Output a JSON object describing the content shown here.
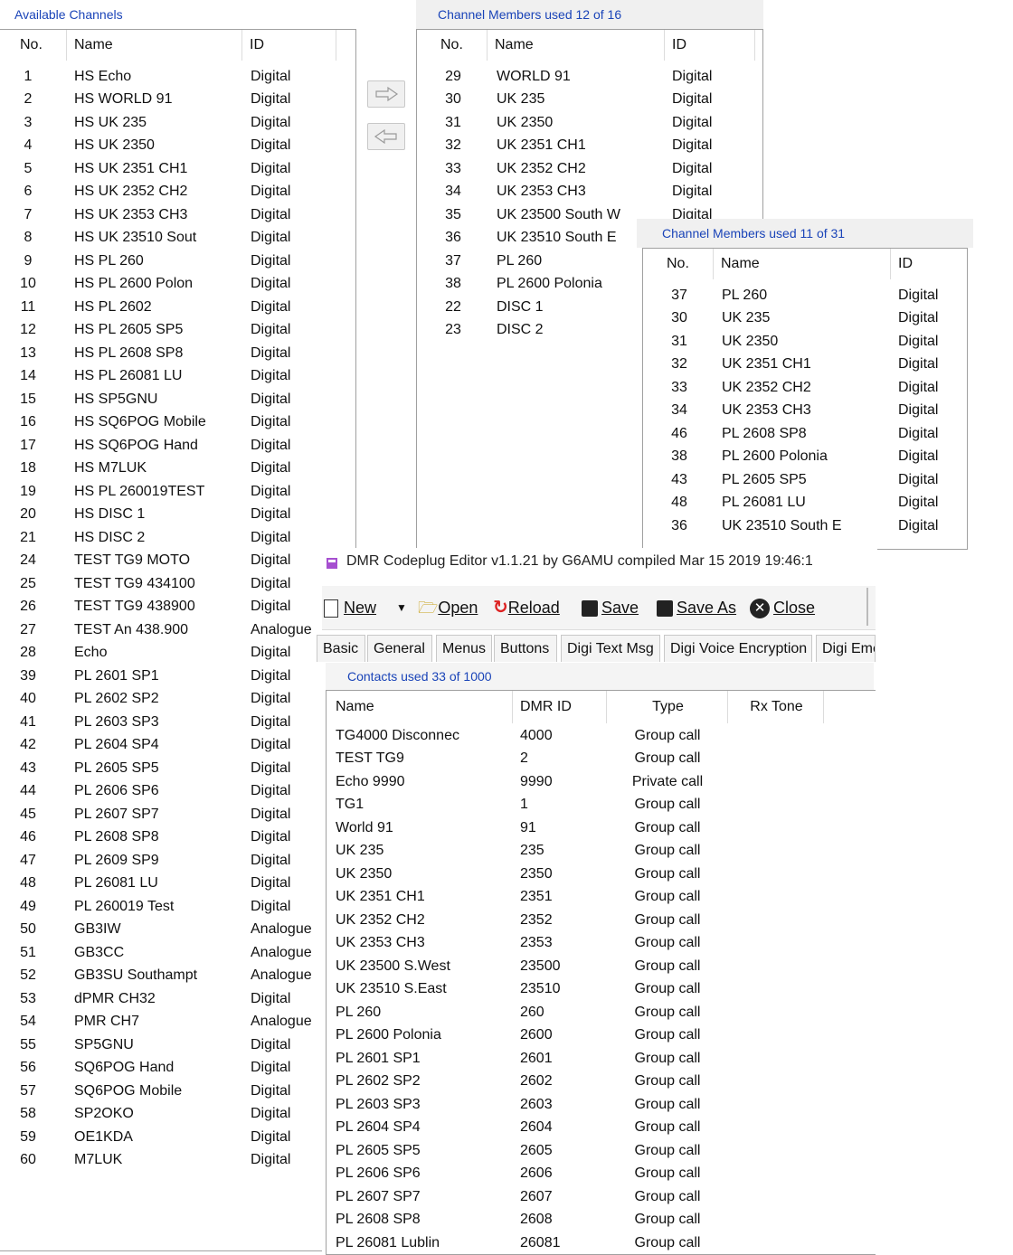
{
  "available": {
    "caption": "Available Channels",
    "headers": [
      "No.",
      "Name",
      "ID"
    ],
    "rows": [
      [
        "1",
        "HS Echo",
        "Digital"
      ],
      [
        "2",
        "HS WORLD 91",
        "Digital"
      ],
      [
        "3",
        "HS UK 235",
        "Digital"
      ],
      [
        "4",
        "HS UK 2350",
        "Digital"
      ],
      [
        "5",
        "HS UK 2351 CH1",
        "Digital"
      ],
      [
        "6",
        "HS UK 2352 CH2",
        "Digital"
      ],
      [
        "7",
        "HS UK 2353 CH3",
        "Digital"
      ],
      [
        "8",
        "HS UK 23510 Sout",
        "Digital"
      ],
      [
        "9",
        "HS PL 260",
        "Digital"
      ],
      [
        "10",
        "HS PL 2600 Polon",
        "Digital"
      ],
      [
        "11",
        "HS PL 2602",
        "Digital"
      ],
      [
        "12",
        "HS PL 2605 SP5",
        "Digital"
      ],
      [
        "13",
        "HS PL 2608 SP8",
        "Digital"
      ],
      [
        "14",
        "HS PL 26081 LU",
        "Digital"
      ],
      [
        "15",
        "HS SP5GNU",
        "Digital"
      ],
      [
        "16",
        "HS SQ6POG Mobile",
        "Digital"
      ],
      [
        "17",
        "HS SQ6POG Hand",
        "Digital"
      ],
      [
        "18",
        "HS M7LUK",
        "Digital"
      ],
      [
        "19",
        "HS PL 260019TEST",
        "Digital"
      ],
      [
        "20",
        "HS DISC 1",
        "Digital"
      ],
      [
        "21",
        "HS DISC 2",
        "Digital"
      ],
      [
        "24",
        "TEST TG9 MOTO",
        "Digital"
      ],
      [
        "25",
        "TEST TG9 434100",
        "Digital"
      ],
      [
        "26",
        "TEST TG9 438900",
        "Digital"
      ],
      [
        "27",
        "TEST An 438.900",
        "Analogue"
      ],
      [
        "28",
        "Echo",
        "Digital"
      ],
      [
        "39",
        "PL 2601 SP1",
        "Digital"
      ],
      [
        "40",
        "PL 2602 SP2",
        "Digital"
      ],
      [
        "41",
        "PL 2603 SP3",
        "Digital"
      ],
      [
        "42",
        "PL 2604 SP4",
        "Digital"
      ],
      [
        "43",
        "PL 2605 SP5",
        "Digital"
      ],
      [
        "44",
        "PL 2606 SP6",
        "Digital"
      ],
      [
        "45",
        "PL 2607 SP7",
        "Digital"
      ],
      [
        "46",
        "PL 2608 SP8",
        "Digital"
      ],
      [
        "47",
        "PL 2609 SP9",
        "Digital"
      ],
      [
        "48",
        "PL 26081 LU",
        "Digital"
      ],
      [
        "49",
        "PL 260019 Test",
        "Digital"
      ],
      [
        "50",
        "GB3IW",
        "Analogue"
      ],
      [
        "51",
        "GB3CC",
        "Analogue"
      ],
      [
        "52",
        "GB3SU Southampt",
        "Analogue"
      ],
      [
        "53",
        "dPMR CH32",
        "Digital"
      ],
      [
        "54",
        "PMR CH7",
        "Analogue"
      ],
      [
        "55",
        "SP5GNU",
        "Digital"
      ],
      [
        "56",
        "SQ6POG Hand",
        "Digital"
      ],
      [
        "57",
        "SQ6POG Mobile",
        "Digital"
      ],
      [
        "58",
        "SP2OKO",
        "Digital"
      ],
      [
        "59",
        "OE1KDA",
        "Digital"
      ],
      [
        "60",
        "M7LUK",
        "Digital"
      ]
    ]
  },
  "members1": {
    "caption": "Channel Members  used 12 of 16",
    "headers": [
      "No.",
      "Name",
      "ID"
    ],
    "rows": [
      [
        "29",
        "WORLD 91",
        "Digital"
      ],
      [
        "30",
        "UK 235",
        "Digital"
      ],
      [
        "31",
        "UK 2350",
        "Digital"
      ],
      [
        "32",
        "UK 2351 CH1",
        "Digital"
      ],
      [
        "33",
        "UK 2352 CH2",
        "Digital"
      ],
      [
        "34",
        "UK 2353 CH3",
        "Digital"
      ],
      [
        "35",
        "UK 23500 South W",
        "Digital"
      ],
      [
        "36",
        "UK 23510 South E",
        ""
      ],
      [
        "37",
        "PL 260",
        ""
      ],
      [
        "38",
        "PL 2600 Polonia",
        ""
      ],
      [
        "22",
        "DISC 1",
        ""
      ],
      [
        "23",
        "DISC 2",
        ""
      ]
    ]
  },
  "members2": {
    "caption": "Channel Members  used 11 of 31",
    "headers": [
      "No.",
      "Name",
      "ID"
    ],
    "rows": [
      [
        "37",
        "PL 260",
        "Digital"
      ],
      [
        "30",
        "UK 235",
        "Digital"
      ],
      [
        "31",
        "UK 2350",
        "Digital"
      ],
      [
        "32",
        "UK 2351 CH1",
        "Digital"
      ],
      [
        "33",
        "UK 2352 CH2",
        "Digital"
      ],
      [
        "34",
        "UK 2353 CH3",
        "Digital"
      ],
      [
        "46",
        "PL 2608 SP8",
        "Digital"
      ],
      [
        "38",
        "PL 2600 Polonia",
        "Digital"
      ],
      [
        "43",
        "PL 2605 SP5",
        "Digital"
      ],
      [
        "48",
        "PL 26081 LU",
        "Digital"
      ],
      [
        "36",
        "UK 23510 South E",
        "Digital"
      ]
    ]
  },
  "editor": {
    "title": "DMR Codeplug Editor v1.1.21 by G6AMU   compiled Mar 15 2019 19:46:1",
    "toolbar": {
      "new": "New",
      "open": "Open",
      "reload": "Reload",
      "save": "Save",
      "save_as": "Save As",
      "close": "Close"
    },
    "tabs": [
      "Basic",
      "General",
      "Menus",
      "Buttons",
      "Digi Text Msg",
      "Digi Voice Encryption",
      "Digi Eme"
    ],
    "contacts_caption": "Contacts   used 33 of 1000",
    "contacts_headers": [
      "Name",
      "DMR ID",
      "Type",
      "Rx Tone"
    ],
    "contacts": [
      [
        "TG4000 Disconnec",
        "4000",
        "Group call"
      ],
      [
        "TEST TG9",
        "2",
        "Group call"
      ],
      [
        "Echo 9990",
        "9990",
        "Private call"
      ],
      [
        "TG1",
        "1",
        "Group call"
      ],
      [
        "World 91",
        "91",
        "Group call"
      ],
      [
        "UK 235",
        "235",
        "Group call"
      ],
      [
        "UK 2350",
        "2350",
        "Group call"
      ],
      [
        "UK 2351 CH1",
        "2351",
        "Group call"
      ],
      [
        "UK 2352 CH2",
        "2352",
        "Group call"
      ],
      [
        "UK 2353 CH3",
        "2353",
        "Group call"
      ],
      [
        "UK 23500 S.West",
        "23500",
        "Group call"
      ],
      [
        "UK 23510 S.East",
        "23510",
        "Group call"
      ],
      [
        "PL 260",
        "260",
        "Group call"
      ],
      [
        "PL 2600 Polonia",
        "2600",
        "Group call"
      ],
      [
        "PL 2601 SP1",
        "2601",
        "Group call"
      ],
      [
        "PL 2602 SP2",
        "2602",
        "Group call"
      ],
      [
        "PL 2603 SP3",
        "2603",
        "Group call"
      ],
      [
        "PL 2604 SP4",
        "2604",
        "Group call"
      ],
      [
        "PL 2605 SP5",
        "2605",
        "Group call"
      ],
      [
        "PL 2606 SP6",
        "2606",
        "Group call"
      ],
      [
        "PL 2607 SP7",
        "2607",
        "Group call"
      ],
      [
        "PL 2608 SP8",
        "2608",
        "Group call"
      ],
      [
        "PL 26081 Lublin",
        "26081",
        "Group call"
      ]
    ]
  }
}
